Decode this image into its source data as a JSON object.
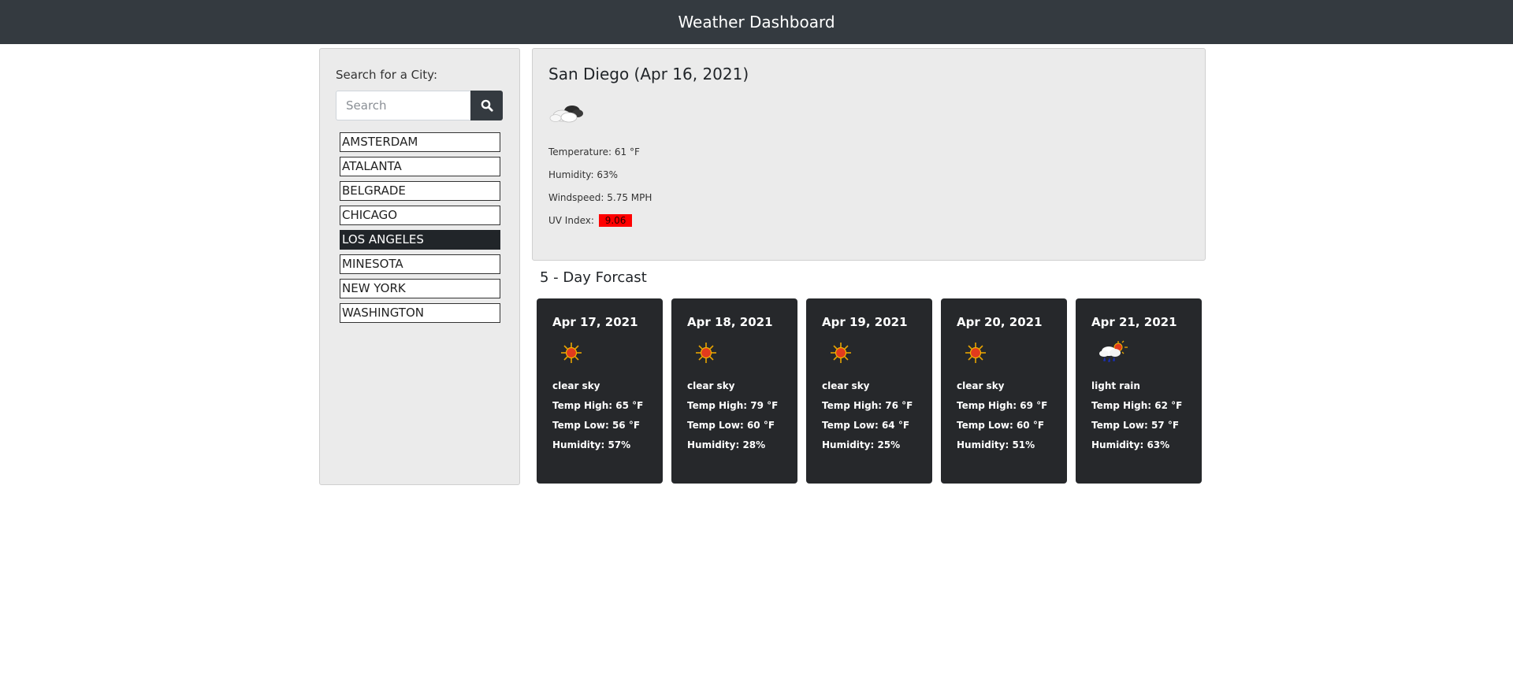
{
  "header": {
    "title": "Weather Dashboard"
  },
  "sidebar": {
    "label": "Search for a City:",
    "search": {
      "placeholder": "Search",
      "value": ""
    },
    "search_icon": "search-icon",
    "cities": [
      "AMSTERDAM",
      "ATALANTA",
      "BELGRADE",
      "CHICAGO",
      "LOS ANGELES",
      "MINESOTA",
      "NEW YORK",
      "WASHINGTON"
    ],
    "active_city": "LOS ANGELES"
  },
  "current": {
    "title": "San Diego (Apr 16, 2021)",
    "icon": "cloudy-icon",
    "temperature": "Temperature: 61 °F",
    "humidity": "Humidity: 63%",
    "windspeed": "Windspeed: 5.75 MPH",
    "uv_label": "UV Index:",
    "uv_value": "9.06",
    "uv_color": "#ff0000"
  },
  "forecast": {
    "title": "5 - Day Forcast",
    "days": [
      {
        "date": "Apr 17, 2021",
        "icon": "sun-icon",
        "desc": "clear sky",
        "high": "Temp High: 65 °F",
        "low": "Temp Low: 56 °F",
        "humidity": "Humidity: 57%"
      },
      {
        "date": "Apr 18, 2021",
        "icon": "sun-icon",
        "desc": "clear sky",
        "high": "Temp High: 79 °F",
        "low": "Temp Low: 60 °F",
        "humidity": "Humidity: 28%"
      },
      {
        "date": "Apr 19, 2021",
        "icon": "sun-icon",
        "desc": "clear sky",
        "high": "Temp High: 76 °F",
        "low": "Temp Low: 64 °F",
        "humidity": "Humidity: 25%"
      },
      {
        "date": "Apr 20, 2021",
        "icon": "sun-icon",
        "desc": "clear sky",
        "high": "Temp High: 69 °F",
        "low": "Temp Low: 60 °F",
        "humidity": "Humidity: 51%"
      },
      {
        "date": "Apr 21, 2021",
        "icon": "rain-sun-icon",
        "desc": "light rain",
        "high": "Temp High: 62 °F",
        "low": "Temp Low: 57 °F",
        "humidity": "Humidity: 63%"
      }
    ]
  },
  "colors": {
    "header_bg": "#343a40",
    "panel_bg": "#ebebeb",
    "card_bg": "#26282b",
    "active_city_bg": "#212529"
  }
}
